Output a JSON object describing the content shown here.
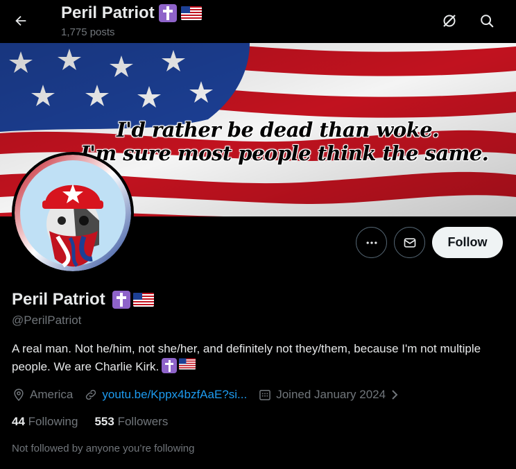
{
  "header": {
    "name": "Peril Patriot",
    "posts_count": "1,775 posts",
    "back_icon": "arrow-left-icon",
    "grok_icon": "grok-icon",
    "search_icon": "search-icon"
  },
  "banner": {
    "line1": "I'd rather be dead than woke.",
    "line2": "I'm sure most people think the same.",
    "colors": {
      "red": "#c1121f",
      "white": "#f4f4f4",
      "blue": "#1c3f94"
    }
  },
  "actions": {
    "more_icon": "more-horizontal-icon",
    "message_icon": "mail-icon",
    "follow_label": "Follow"
  },
  "profile": {
    "name": "Peril Patriot",
    "handle": "@PerilPatriot",
    "bio": "A real man. Not he/him, not she/her, and definitely not they/them, because I'm not multiple people. We are Charlie Kirk.",
    "location": "America",
    "location_icon": "location-pin-icon",
    "link": "youtu.be/Kppx4bzfAaE?si...",
    "link_icon": "link-icon",
    "joined": "Joined January 2024",
    "joined_icon": "calendar-icon",
    "chevron_icon": "chevron-right-icon"
  },
  "stats": {
    "following_count": "44",
    "following_label": "Following",
    "followers_count": "553",
    "followers_label": "Followers"
  },
  "footer_note": "Not followed by anyone you’re following",
  "theme": {
    "background": "#000000",
    "text": "#e7e9ea",
    "muted": "#71767b",
    "link": "#1d9bf0",
    "cross_badge": "#8e63c9"
  }
}
